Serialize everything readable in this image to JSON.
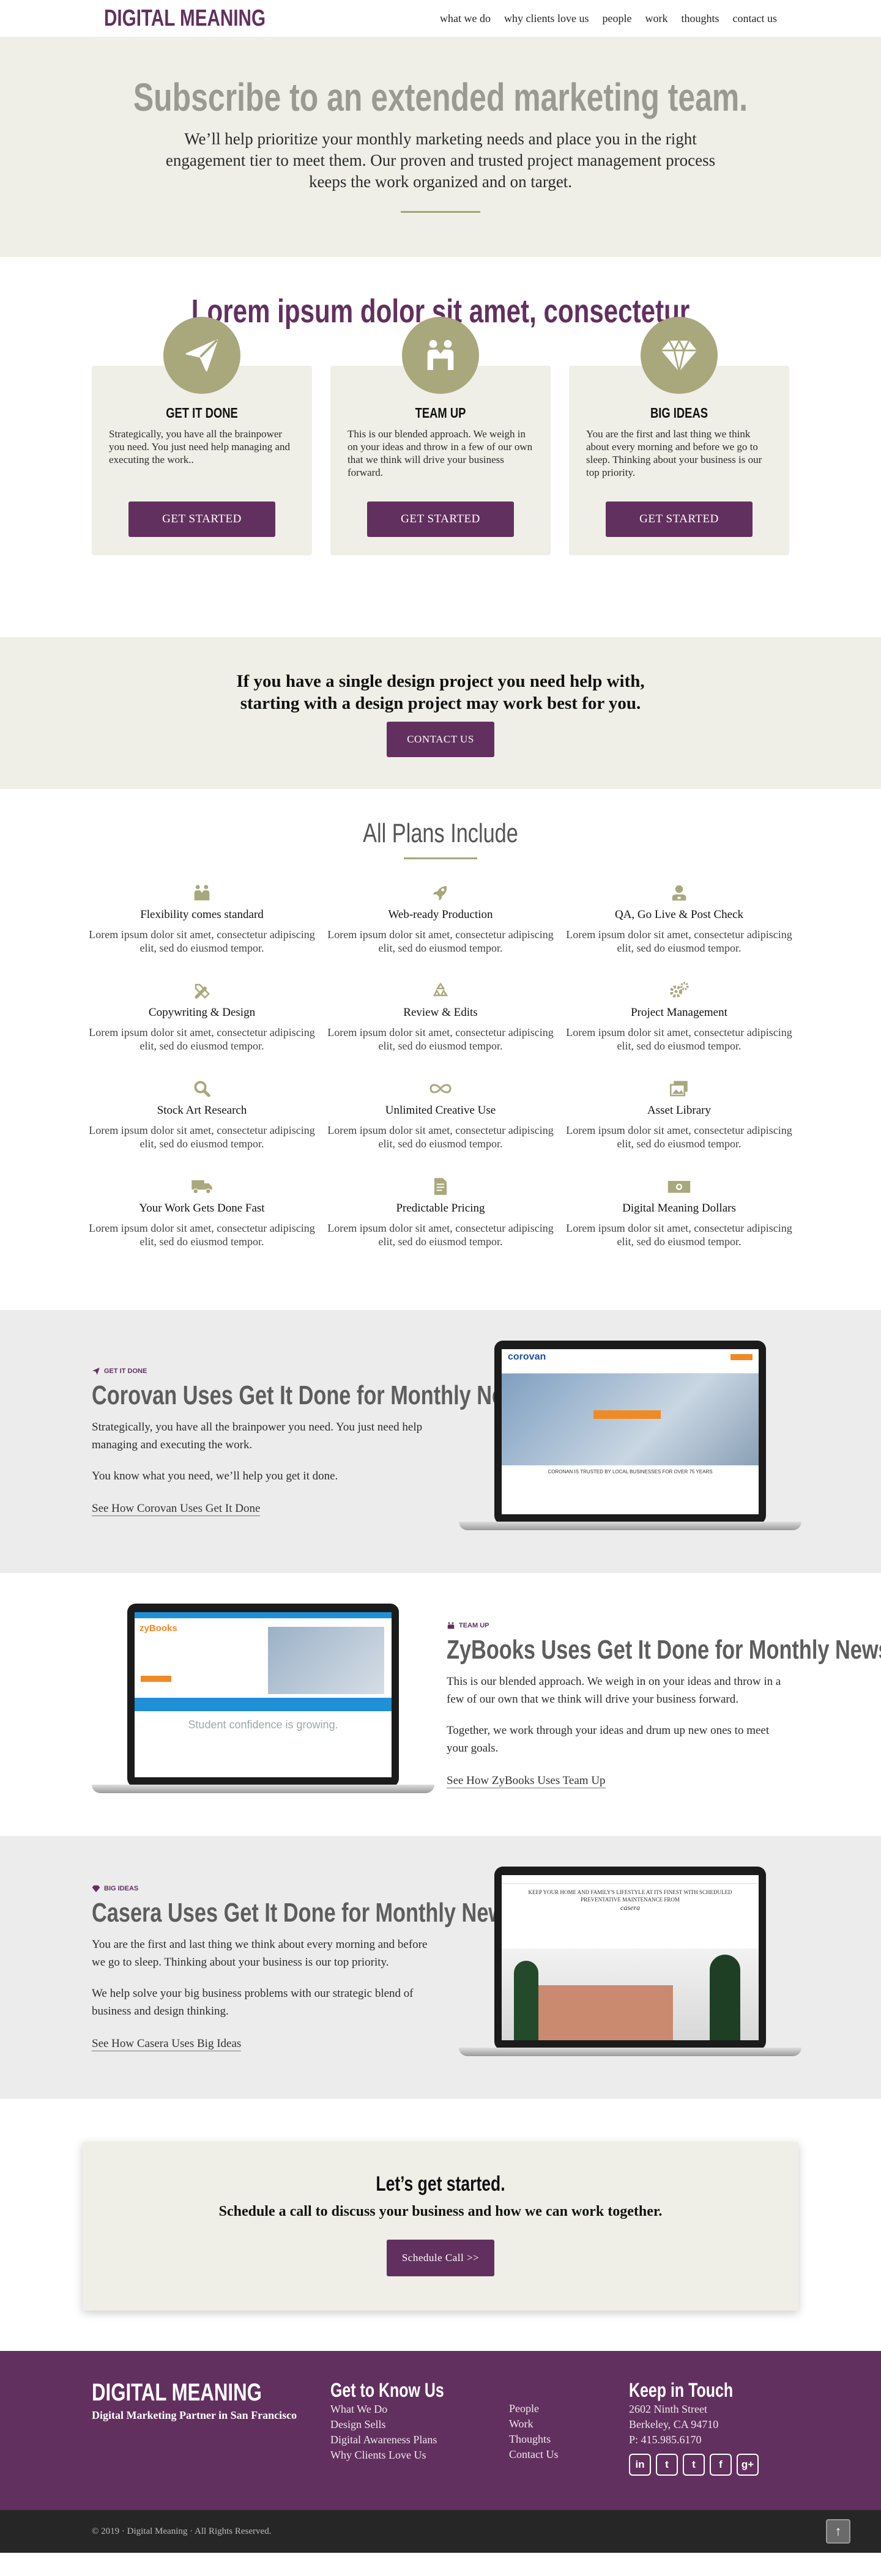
{
  "header": {
    "logo": "DIGITAL MEANING",
    "nav": [
      "what we do",
      "why clients love us",
      "people",
      "work",
      "thoughts",
      "contact us"
    ]
  },
  "hero": {
    "title": "Subscribe to an extended marketing team.",
    "text": "We’ll help prioritize your monthly marketing needs and place you in the right engagement tier to meet them. Our proven and trusted project management process keeps the work organized and on target."
  },
  "plans": {
    "heading": "Lorem ipsum dolor sit amet, consectetur",
    "cards": [
      {
        "icon": "paper-plane-icon",
        "title": "GET IT DONE",
        "text": "Strategically, you have all the brainpower you need. You just need help managing and executing the work..",
        "button": "GET STARTED"
      },
      {
        "icon": "team-icon",
        "title": "TEAM UP",
        "text": "This is our blended approach. We weigh in on your ideas and throw in a few of our own that we think will drive your business forward.",
        "button": "GET STARTED"
      },
      {
        "icon": "diamond-icon",
        "title": "BIG IDEAS",
        "text": "You are the first and last  thing we think about every morning and before we go to sleep. Thinking about your business is our top priority.",
        "button": "GET STARTED"
      }
    ]
  },
  "project": {
    "text": "If you have a single design project you need help with, starting with a design project may work best for you.",
    "button": "CONTACT US"
  },
  "features": {
    "heading": "All Plans Include",
    "items": [
      {
        "title": "Flexibility comes standard",
        "text": "Lorem ipsum dolor sit amet, consectetur adipiscing elit, sed do eiusmod tempor."
      },
      {
        "title": "Web-ready Production",
        "text": "Lorem ipsum dolor sit amet, consectetur adipiscing elit, sed do eiusmod tempor."
      },
      {
        "title": "QA, Go Live & Post Check",
        "text": "Lorem ipsum dolor sit amet, consectetur adipiscing elit, sed do eiusmod tempor."
      },
      {
        "title": "Copywriting & Design",
        "text": "Lorem ipsum dolor sit amet, consectetur adipiscing elit, sed do eiusmod tempor."
      },
      {
        "title": "Review & Edits",
        "text": "Lorem ipsum dolor sit amet, consectetur adipiscing elit, sed do eiusmod tempor."
      },
      {
        "title": "Project Management",
        "text": "Lorem ipsum dolor sit amet, consectetur adipiscing elit, sed do eiusmod tempor."
      },
      {
        "title": "Stock Art Research",
        "text": "Lorem ipsum dolor sit amet, consectetur adipiscing elit, sed do eiusmod tempor."
      },
      {
        "title": "Unlimited Creative Use",
        "text": "Lorem ipsum dolor sit amet, consectetur adipiscing elit, sed do eiusmod tempor."
      },
      {
        "title": "Asset Library",
        "text": "Lorem ipsum dolor sit amet, consectetur adipiscing elit, sed do eiusmod tempor."
      },
      {
        "title": "Your Work Gets Done Fast",
        "text": "Lorem ipsum dolor sit amet, consectetur adipiscing elit, sed do eiusmod tempor."
      },
      {
        "title": "Predictable Pricing",
        "text": "Lorem ipsum dolor sit amet, consectetur adipiscing elit, sed do eiusmod tempor."
      },
      {
        "title": "Digital Meaning Dollars",
        "text": "Lorem ipsum dolor sit amet, consectetur adipiscing elit, sed do eiusmod tempor."
      }
    ]
  },
  "cases": [
    {
      "tag": "GET IT DONE",
      "title": "Corovan Uses Get It Done for Monthly News",
      "para1": "Strategically, you have all the brainpower you need. You just need help managing and executing the work.",
      "para2": "You know what you need, we’ll help you get it done.",
      "link": "See How Corovan Uses Get It Done",
      "screen_logo": "corovan",
      "screen_caption": "CORONAN IS TRUSTED BY LOCAL BUSINESSES FOR OVER 75 YEARS"
    },
    {
      "tag": "TEAM UP",
      "title": "ZyBooks Uses Get It Done for Monthly News",
      "para1": "This is our blended approach. We weigh in on your ideas and throw in a few of our own that we think will drive your business forward.",
      "para2": "Together, we work through your ideas and drum up new ones to meet your goals.",
      "link": "See How ZyBooks Uses Team Up",
      "screen_logo": "zyBooks",
      "screen_caption": "Student confidence is growing."
    },
    {
      "tag": "BIG IDEAS",
      "title": "Casera Uses Get It Done for Monthly News",
      "para1": "You are the first and last  thing we think about every morning and before we go to sleep. Thinking about your business is our top priority.",
      "para2": "We help solve your big business problems with our strategic blend of business and design thinking.",
      "link": "See How Casera Uses Big Ideas",
      "screen_logo": "casera",
      "screen_caption": "KEEP YOUR HOME AND FAMILY'S LIFESTYLE AT ITS FINEST WITH SCHEDULED PREVENTATIVE MAINTENANCE FROM"
    }
  ],
  "cta": {
    "title": "Let’s get started.",
    "text": "Schedule a call to discuss your business and how we can work together.",
    "button": "Schedule Call >>"
  },
  "footer": {
    "logo": "DIGITAL MEANING",
    "tagline": "Digital Marketing Partner in San Francisco",
    "know_title": "Get to Know Us",
    "links_a": [
      "What We Do",
      "Design Sells",
      "Digital Awareness Plans",
      "Why Clients Love Us"
    ],
    "links_b": [
      "People",
      "Work",
      "Thoughts",
      "Contact Us"
    ],
    "touch_title": "Keep in Touch",
    "address1": "2602 Ninth Street",
    "address2": "Berkeley, CA 94710",
    "phone": "P: 415.985.6170",
    "social": [
      "in",
      "t",
      "t",
      "f",
      "g+"
    ],
    "copyright": "© 2019 · Digital Meaning · All Rights Reserved."
  },
  "colors": {
    "brand": "#62305f",
    "olive": "#a9a77c",
    "cream": "#efefe8"
  }
}
